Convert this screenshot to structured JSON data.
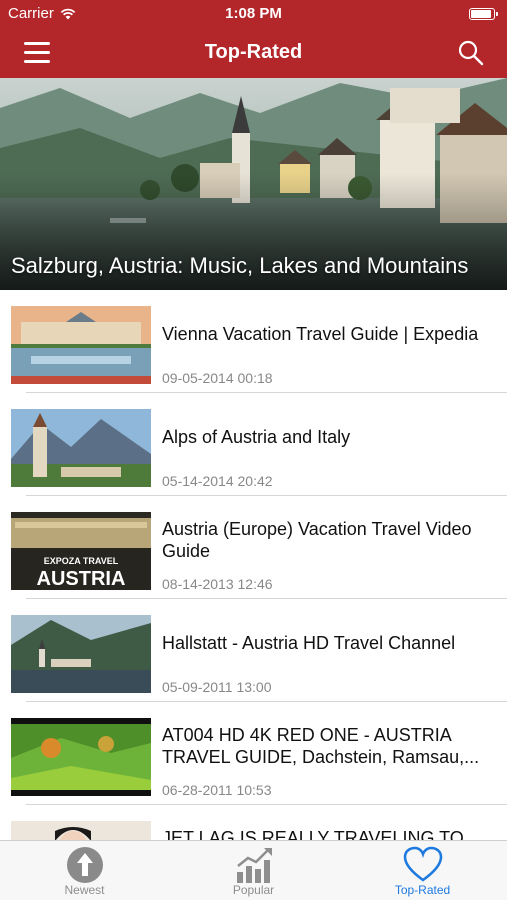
{
  "status_bar": {
    "carrier": "Carrier",
    "time": "1:08 PM"
  },
  "nav": {
    "title": "Top-Rated"
  },
  "hero": {
    "title": "Salzburg, Austria: Music, Lakes and Mountains"
  },
  "videos": [
    {
      "title": "Vienna Vacation Travel Guide | Expedia",
      "date": "09-05-2014 00:18"
    },
    {
      "title": "Alps of Austria and Italy",
      "date": "05-14-2014 20:42"
    },
    {
      "title": "Austria (Europe) Vacation Travel Video Guide",
      "date": "08-14-2013 12:46",
      "thumb_caption_1": "EXPOZA TRAVEL",
      "thumb_caption_2": "AUSTRIA"
    },
    {
      "title": "Hallstatt - Austria HD Travel Channel",
      "date": "05-09-2011 13:00"
    },
    {
      "title": "AT004 HD 4K RED ONE - AUSTRIA TRAVEL GUIDE, Dachstein, Ramsau,...",
      "date": "06-28-2011 10:53"
    },
    {
      "title": "JET LAG IS REALLY TRAVELING TO",
      "date": ""
    }
  ],
  "tabs": [
    {
      "label": "Newest",
      "icon": "arrow-up-circle-icon"
    },
    {
      "label": "Popular",
      "icon": "chart-trend-icon"
    },
    {
      "label": "Top-Rated",
      "icon": "heart-icon",
      "active": true
    }
  ],
  "colors": {
    "brand_red": "#b3272b",
    "active_tab_blue": "#1f7ae0",
    "date_gray": "#888888"
  }
}
